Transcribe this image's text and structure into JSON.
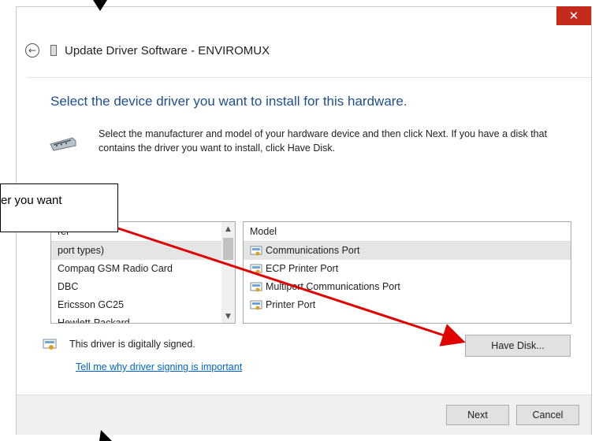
{
  "window": {
    "close_glyph": "✕",
    "title": "Update Driver Software - ENVIROMUX"
  },
  "main": {
    "heading": "Select the device driver you want to install for this hardware.",
    "description": "Select the manufacturer and model of your hardware device and then click Next. If you have a disk that contains the driver you want to install, click Have Disk.",
    "manufacturer_list": {
      "header_partial": "rer",
      "items": [
        "port types)",
        "Compaq GSM Radio Card",
        "DBC",
        "Ericsson GC25",
        "Hewlett-Packard"
      ]
    },
    "model_list": {
      "header": "Model",
      "items": [
        "Communications Port",
        "ECP Printer Port",
        "Multiport Communications Port",
        "Printer Port"
      ]
    },
    "signed_text": "This driver is digitally signed.",
    "signing_link": "Tell me why driver signing is important",
    "have_disk_label": "Have Disk..."
  },
  "footer": {
    "next_label": "Next",
    "cancel_label": "Cancel"
  },
  "callout": {
    "text": "er you want"
  },
  "colors": {
    "close": "#c42b1c",
    "heading": "#1e4e8c",
    "link": "#0066cc",
    "arrow": "#e00000"
  }
}
